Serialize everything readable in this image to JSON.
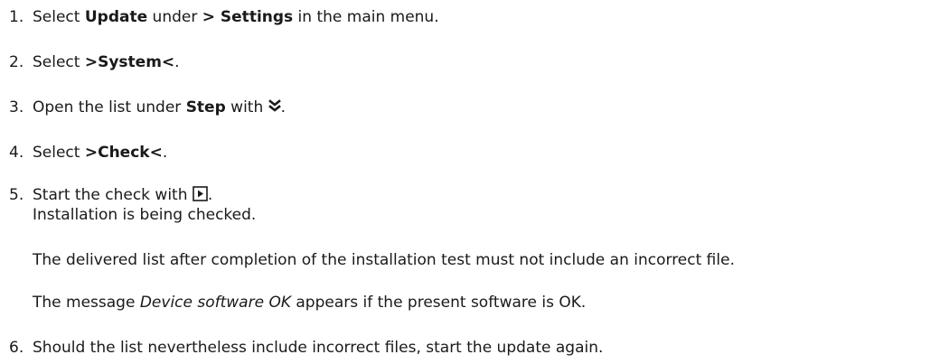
{
  "steps": [
    {
      "num": "1.",
      "pre": "Select ",
      "bold1": "Update",
      "mid": " under ",
      "bold2": "> Settings",
      "post": " in the main menu."
    },
    {
      "num": "2.",
      "pre": "Select ",
      "bold1": ">System<",
      "post": "."
    },
    {
      "num": "3.",
      "pre": "Open the list under ",
      "bold1": "Step",
      "mid": " with ",
      "icon": "double-chevron-down-icon",
      "post": "."
    },
    {
      "num": "4.",
      "pre": "Select ",
      "bold1": ">Check<",
      "post": "."
    },
    {
      "num": "5.",
      "pre": "Start the check with ",
      "icon": "play-button-icon",
      "post": ".",
      "line2": "Installation is being checked."
    },
    {
      "num": "6.",
      "text": "Should the list nevertheless include incorrect files, start the update again."
    }
  ],
  "notes": {
    "note1": "The delivered list after completion of the installation test must not include an incorrect file.",
    "note2_pre": "The message ",
    "note2_italic": "Device software OK",
    "note2_post": " appears if the present software is OK."
  }
}
